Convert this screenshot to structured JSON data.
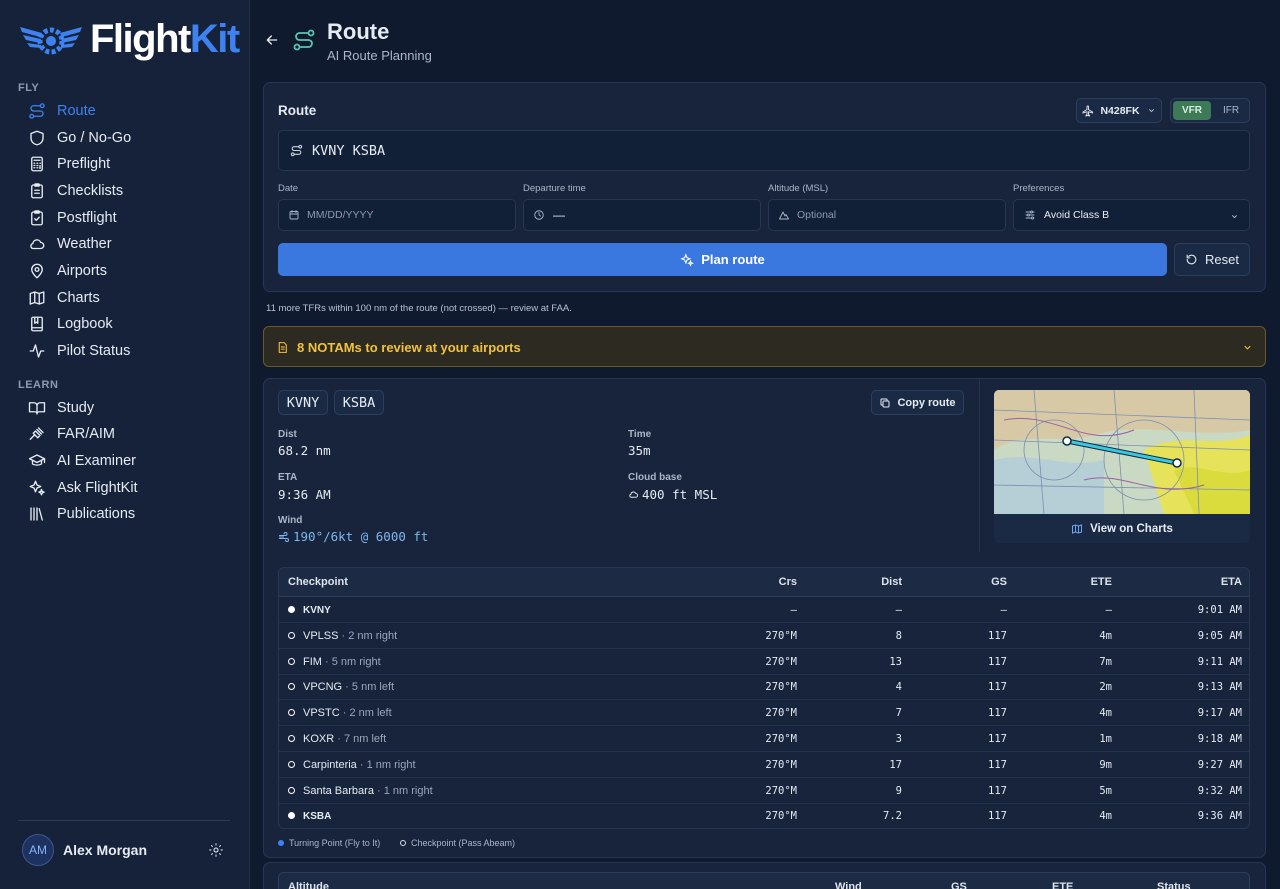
{
  "app": {
    "brand_part1": "Flight",
    "brand_part2": "Kit"
  },
  "sidebar": {
    "fly_label": "FLY",
    "fly_items": [
      {
        "label": "Route",
        "icon": "route-icon",
        "active": true
      },
      {
        "label": "Go / No-Go",
        "icon": "shield-icon"
      },
      {
        "label": "Preflight",
        "icon": "calculator-icon"
      },
      {
        "label": "Checklists",
        "icon": "clipboard-list-icon"
      },
      {
        "label": "Postflight",
        "icon": "clipboard-check-icon"
      },
      {
        "label": "Weather",
        "icon": "cloud-icon"
      },
      {
        "label": "Airports",
        "icon": "map-pin-icon"
      },
      {
        "label": "Charts",
        "icon": "map-icon"
      },
      {
        "label": "Logbook",
        "icon": "book-icon"
      },
      {
        "label": "Pilot Status",
        "icon": "activity-icon"
      }
    ],
    "learn_label": "LEARN",
    "learn_items": [
      {
        "label": "Study",
        "icon": "open-book-icon"
      },
      {
        "label": "FAR/AIM",
        "icon": "gavel-icon"
      },
      {
        "label": "AI Examiner",
        "icon": "graduation-cap-icon"
      },
      {
        "label": "Ask FlightKit",
        "icon": "sparkles-icon"
      },
      {
        "label": "Publications",
        "icon": "library-icon"
      }
    ],
    "user": {
      "initials": "AM",
      "name": "Alex Morgan"
    }
  },
  "header": {
    "title": "Route",
    "subtitle": "AI Route Planning"
  },
  "route_form": {
    "heading": "Route",
    "aircraft": "N428FK",
    "rules": {
      "vfr": "VFR",
      "ifr": "IFR",
      "selected": "VFR"
    },
    "route_value": "KVNY KSBA",
    "date_label": "Date",
    "date_placeholder": "MM/DD/YYYY",
    "time_label": "Departure time",
    "time_value": "—",
    "altitude_label": "Altitude (MSL)",
    "altitude_placeholder": "Optional",
    "prefs_label": "Preferences",
    "prefs_value": "Avoid Class B",
    "plan_button": "Plan route",
    "reset_button": "Reset"
  },
  "tfr_note": "11 more TFRs within 100 nm of the route (not crossed) — review at FAA.",
  "notam_banner": "8 NOTAMs to review at your airports",
  "summary": {
    "from": "KVNY",
    "to": "KSBA",
    "copy_button": "Copy route",
    "dist_label": "Dist",
    "dist_value": "68.2 nm",
    "time_label": "Time",
    "time_value": "35m",
    "eta_label": "ETA",
    "eta_value": "9:36 AM",
    "cloud_label": "Cloud base",
    "cloud_value": "400 ft MSL",
    "wind_label": "Wind",
    "wind_value": "190°/6kt @ 6000 ft",
    "map_button": "View on Charts"
  },
  "checkpoints": {
    "headers": {
      "checkpoint": "Checkpoint",
      "crs": "Crs",
      "dist": "Dist",
      "gs": "GS",
      "ete": "ETE",
      "eta": "ETA"
    },
    "rows": [
      {
        "name": "KVNY",
        "note": "",
        "type": "turning",
        "crs": "—",
        "dist": "—",
        "gs": "—",
        "ete": "—",
        "eta": "9:01 AM"
      },
      {
        "name": "VPLSS",
        "note": " · 2 nm right",
        "type": "abeam",
        "crs": "270°M",
        "dist": "8",
        "gs": "117",
        "ete": "4m",
        "eta": "9:05 AM"
      },
      {
        "name": "FIM",
        "note": " · 5 nm right",
        "type": "abeam",
        "crs": "270°M",
        "dist": "13",
        "gs": "117",
        "ete": "7m",
        "eta": "9:11 AM"
      },
      {
        "name": "VPCNG",
        "note": " · 5 nm left",
        "type": "abeam",
        "crs": "270°M",
        "dist": "4",
        "gs": "117",
        "ete": "2m",
        "eta": "9:13 AM"
      },
      {
        "name": "VPSTC",
        "note": " · 2 nm left",
        "type": "abeam",
        "crs": "270°M",
        "dist": "7",
        "gs": "117",
        "ete": "4m",
        "eta": "9:17 AM"
      },
      {
        "name": "KOXR",
        "note": " · 7 nm left",
        "type": "abeam",
        "crs": "270°M",
        "dist": "3",
        "gs": "117",
        "ete": "1m",
        "eta": "9:18 AM"
      },
      {
        "name": "Carpinteria",
        "note": " · 1 nm right",
        "type": "abeam",
        "crs": "270°M",
        "dist": "17",
        "gs": "117",
        "ete": "9m",
        "eta": "9:27 AM"
      },
      {
        "name": "Santa Barbara",
        "note": " · 1 nm right",
        "type": "abeam",
        "crs": "270°M",
        "dist": "9",
        "gs": "117",
        "ete": "5m",
        "eta": "9:32 AM"
      },
      {
        "name": "KSBA",
        "note": "",
        "type": "turning",
        "crs": "270°M",
        "dist": "7.2",
        "gs": "117",
        "ete": "4m",
        "eta": "9:36 AM"
      }
    ],
    "legend_turning": "Turning Point (Fly to It)",
    "legend_abeam": "Checkpoint (Pass Abeam)"
  },
  "altitude_table": {
    "headers": {
      "altitude": "Altitude",
      "wind": "Wind",
      "gs": "GS",
      "ete": "ETE",
      "status": "Status"
    }
  },
  "colors": {
    "accent": "#3a78e0",
    "warning": "#f3c23d",
    "vfr": "#3f7a58",
    "background": "#0f1a2e"
  }
}
